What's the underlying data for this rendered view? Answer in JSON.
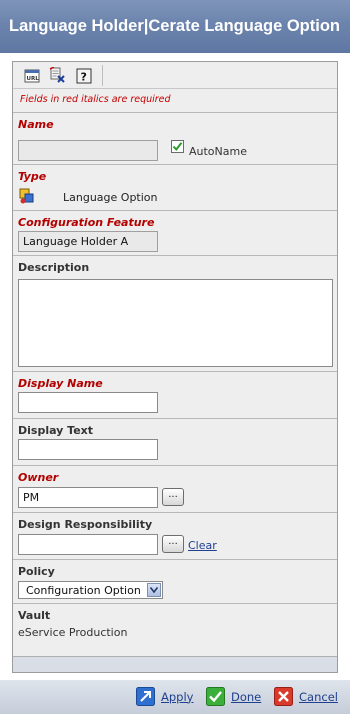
{
  "window": {
    "title": "Language Holder|Cerate Language Option"
  },
  "toolbar": {
    "url_icon": "url-icon",
    "clear_icon": "field-clear-icon",
    "help_icon": "help-icon"
  },
  "required_note": "Fields in red italics are required",
  "fields": {
    "name": {
      "label": "Name",
      "value": "",
      "autoname_label": "AutoName",
      "autoname_checked": true
    },
    "type": {
      "label": "Type",
      "value": "Language Option",
      "icon": "language-option-icon"
    },
    "configuration_feature": {
      "label": "Configuration Feature",
      "value": "Language Holder A"
    },
    "description": {
      "label": "Description",
      "value": ""
    },
    "display_name": {
      "label": "Display Name",
      "value": ""
    },
    "display_text": {
      "label": "Display Text",
      "value": ""
    },
    "owner": {
      "label": "Owner",
      "value": "PM",
      "browse_label": "..."
    },
    "design_responsibility": {
      "label": "Design Responsibility",
      "value": "",
      "browse_label": "...",
      "clear_label": "Clear"
    },
    "policy": {
      "label": "Policy",
      "selected": "Configuration Option"
    },
    "vault": {
      "label": "Vault",
      "value": "eService Production"
    }
  },
  "footer": {
    "apply": "Apply",
    "done": "Done",
    "cancel": "Cancel"
  },
  "colors": {
    "title_bg": "#6c84ad",
    "required_red": "#b30000",
    "link_blue": "#1f3f8f",
    "panel_bg": "#eeeeee"
  }
}
